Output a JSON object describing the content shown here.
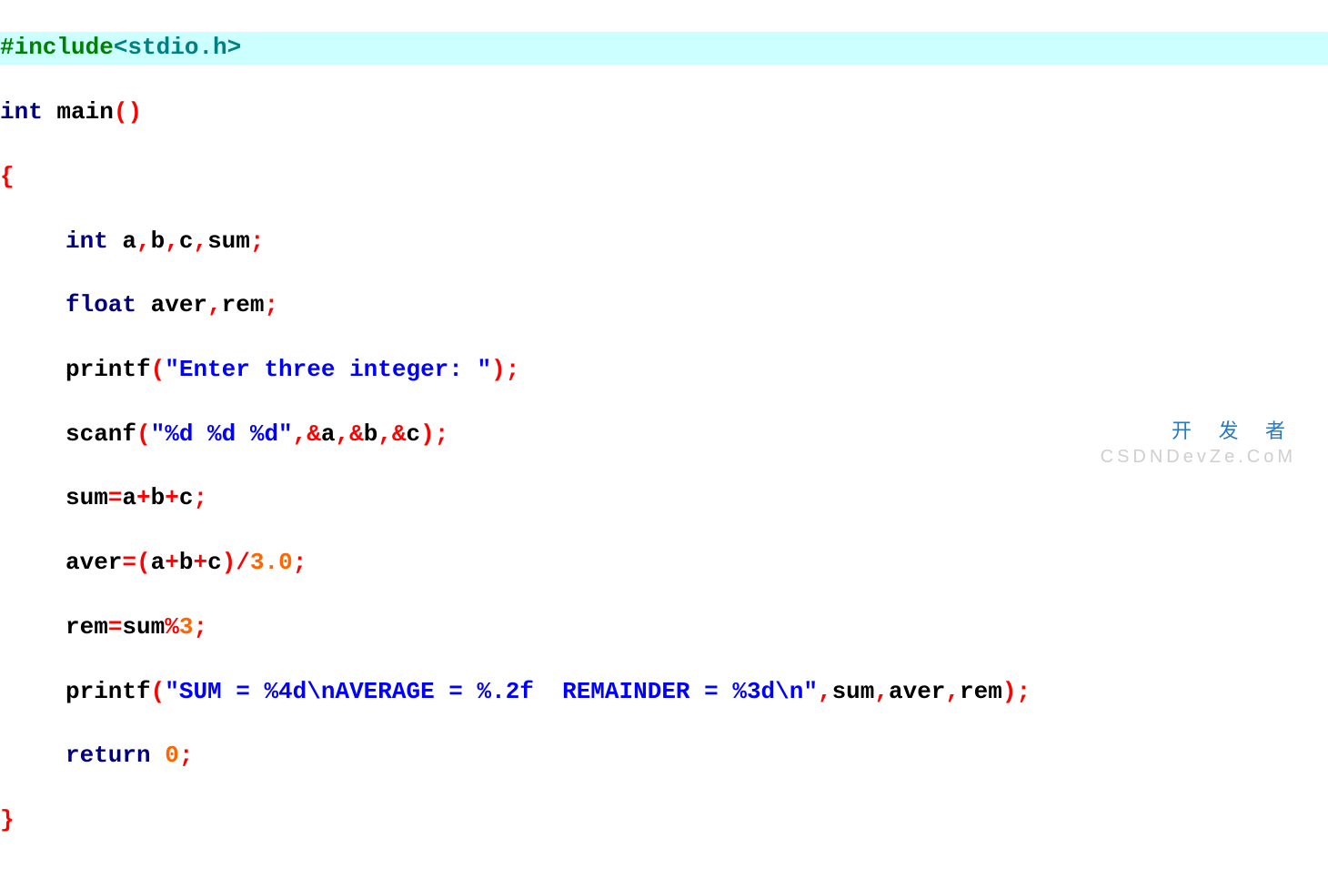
{
  "code": {
    "l1_preproc": "#include",
    "l1_header": "<stdio.h>",
    "l2_kw_int": "int",
    "l2_main": " main",
    "l2_parens_open": "(",
    "l2_parens_close": ")",
    "l3_brace": "{",
    "l4_kw_int": "int",
    "l4_vars": " a",
    "l4_c1": ",",
    "l4_v2": "b",
    "l4_c2": ",",
    "l4_v3": "c",
    "l4_c3": ",",
    "l4_v4": "sum",
    "l4_semi": ";",
    "l5_kw_float": "float",
    "l5_v1": " aver",
    "l5_c1": ",",
    "l5_v2": "rem",
    "l5_semi": ";",
    "l6_func": "printf",
    "l6_po": "(",
    "l6_str": "\"Enter three integer: \"",
    "l6_pc": ")",
    "l6_semi": ";",
    "l7_func": "scanf",
    "l7_po": "(",
    "l7_str": "\"%d %d %d\"",
    "l7_c1": ",",
    "l7_amp1": "&",
    "l7_a": "a",
    "l7_c2": ",",
    "l7_amp2": "&",
    "l7_b": "b",
    "l7_c3": ",",
    "l7_amp3": "&",
    "l7_cc": "c",
    "l7_pc": ")",
    "l7_semi": ";",
    "l8_lhs": "sum",
    "l8_eq": "=",
    "l8_a": "a",
    "l8_op1": "+",
    "l8_b": "b",
    "l8_op2": "+",
    "l8_c": "c",
    "l8_semi": ";",
    "l9_lhs": "aver",
    "l9_eq": "=",
    "l9_po": "(",
    "l9_a": "a",
    "l9_op1": "+",
    "l9_b": "b",
    "l9_op2": "+",
    "l9_c": "c",
    "l9_pc": ")",
    "l9_div": "/",
    "l9_num": "3.0",
    "l9_semi": ";",
    "l10_lhs": "rem",
    "l10_eq": "=",
    "l10_sum": "sum",
    "l10_mod": "%",
    "l10_n": "3",
    "l10_semi": ";",
    "l11_func": "printf",
    "l11_po": "(",
    "l11_str": "\"SUM = %4d\\nAVERAGE = %.2f  REMAINDER = %3d\\n\"",
    "l11_c1": ",",
    "l11_a1": "sum",
    "l11_c2": ",",
    "l11_a2": "aver",
    "l11_c3": ",",
    "l11_a3": "rem",
    "l11_pc": ")",
    "l11_semi": ";",
    "l12_kw_return": "return",
    "l12_sp": " ",
    "l12_num": "0",
    "l12_semi": ";",
    "l13_brace": "}"
  },
  "watermark1": "开 发 者",
  "watermark2": "CSDNDevZe.CoM"
}
